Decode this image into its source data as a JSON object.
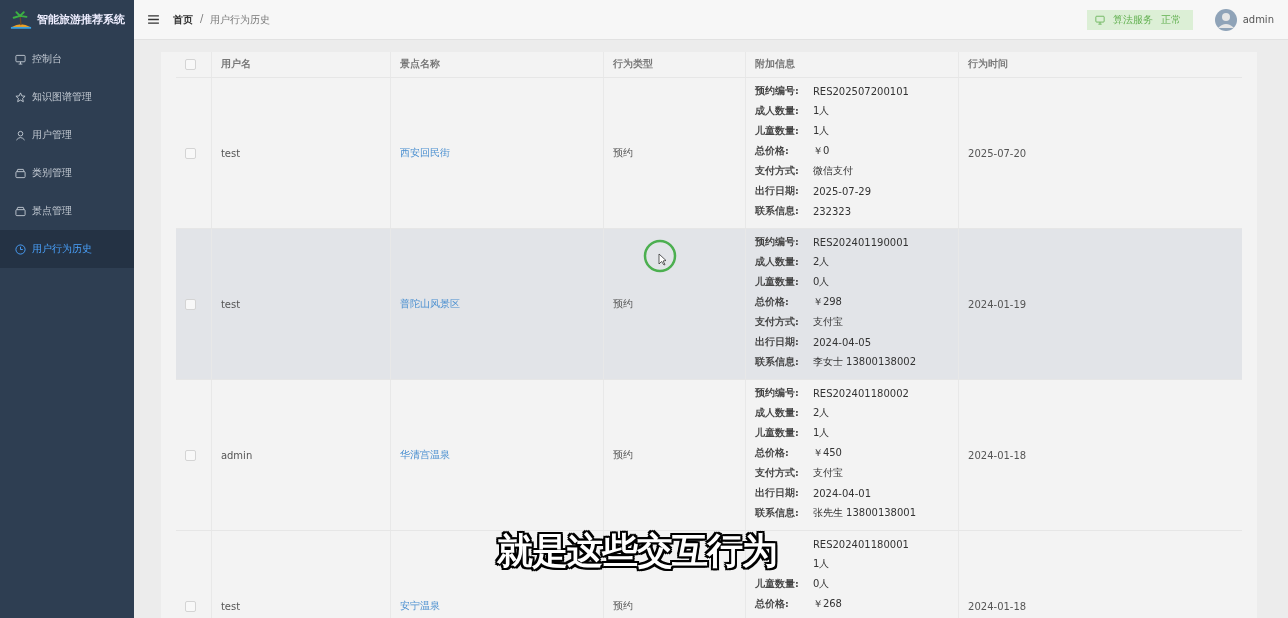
{
  "app": {
    "title": "智能旅游推荐系统"
  },
  "sidebar": {
    "items": [
      {
        "label": "控制台",
        "selected": false
      },
      {
        "label": "知识图谱管理",
        "selected": false
      },
      {
        "label": "用户管理",
        "selected": false
      },
      {
        "label": "类别管理",
        "selected": false
      },
      {
        "label": "景点管理",
        "selected": false
      },
      {
        "label": "用户行为历史",
        "selected": true
      }
    ]
  },
  "header": {
    "breadcrumb": [
      {
        "label": "首页",
        "current": false
      },
      {
        "label": "/",
        "kind": "separator"
      },
      {
        "label": "用户行为历史",
        "current": true
      }
    ],
    "service": {
      "label": "算法服务",
      "status": "正常",
      "ok": true
    },
    "user": "admin"
  },
  "table": {
    "all_checked": false,
    "columns": [
      "用户名",
      "景点名称",
      "行为类型",
      "附加信息",
      "行为时间"
    ],
    "rows": [
      {
        "checked": false,
        "hovered": false,
        "user": "test",
        "spot": "西安回民街",
        "action": "预约",
        "time": "2025-07-20",
        "details": [
          {
            "label": "预约编号:",
            "value": "RES202507200101"
          },
          {
            "label": "成人数量:",
            "value": "1人"
          },
          {
            "label": "儿童数量:",
            "value": "1人"
          },
          {
            "label": "总价格:",
            "value": "￥0"
          },
          {
            "label": "支付方式:",
            "value": "微信支付"
          },
          {
            "label": "出行日期:",
            "value": "2025-07-29"
          },
          {
            "label": "联系信息:",
            "value": "232323"
          }
        ]
      },
      {
        "checked": false,
        "hovered": true,
        "user": "test",
        "spot": "普陀山风景区",
        "action": "预约",
        "time": "2024-01-19",
        "details": [
          {
            "label": "预约编号:",
            "value": "RES202401190001"
          },
          {
            "label": "成人数量:",
            "value": "2人"
          },
          {
            "label": "儿童数量:",
            "value": "0人"
          },
          {
            "label": "总价格:",
            "value": "￥298"
          },
          {
            "label": "支付方式:",
            "value": "支付宝"
          },
          {
            "label": "出行日期:",
            "value": "2024-04-05"
          },
          {
            "label": "联系信息:",
            "value": "李女士 13800138002"
          }
        ]
      },
      {
        "checked": false,
        "hovered": false,
        "user": "admin",
        "spot": "华清宫温泉",
        "action": "预约",
        "time": "2024-01-18",
        "details": [
          {
            "label": "预约编号:",
            "value": "RES202401180002"
          },
          {
            "label": "成人数量:",
            "value": "2人"
          },
          {
            "label": "儿童数量:",
            "value": "1人"
          },
          {
            "label": "总价格:",
            "value": "￥450"
          },
          {
            "label": "支付方式:",
            "value": "支付宝"
          },
          {
            "label": "出行日期:",
            "value": "2024-04-01"
          },
          {
            "label": "联系信息:",
            "value": "张先生 13800138001"
          }
        ]
      },
      {
        "checked": false,
        "hovered": false,
        "user": "test",
        "spot": "安宁温泉",
        "action": "预约",
        "time": "2024-01-18",
        "details": [
          {
            "value": "RES202401180001"
          },
          {
            "value": "1人"
          },
          {
            "label": "儿童数量:",
            "value": "0人"
          },
          {
            "label": "总价格:",
            "value": "￥268"
          }
        ]
      }
    ]
  },
  "subtitle": "就是这些交互行为"
}
